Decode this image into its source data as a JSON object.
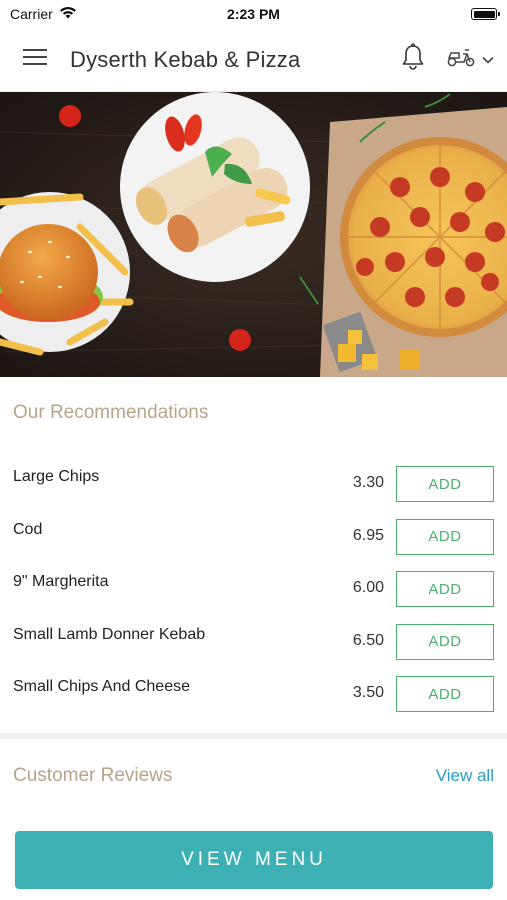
{
  "status_bar": {
    "carrier": "Carrier",
    "time": "2:23 PM",
    "wifi_icon": "wifi-icon",
    "battery_icon": "battery-icon"
  },
  "header": {
    "title": "Dyserth Kebab & Pizza",
    "menu_icon": "hamburger-menu-icon",
    "notification_icon": "bell-icon",
    "delivery_icon": "scooter-icon",
    "dropdown_icon": "chevron-down-icon"
  },
  "hero": {
    "image": "food-banner-burger-wrap-pizza"
  },
  "recommendations": {
    "title": "Our Recommendations",
    "add_label": "ADD",
    "items": [
      {
        "name": "Large Chips",
        "price": "3.30"
      },
      {
        "name": "Cod",
        "price": "6.95"
      },
      {
        "name": "9\" Margherita",
        "price": "6.00"
      },
      {
        "name": "Small Lamb Donner Kebab",
        "price": "6.50"
      },
      {
        "name": "Small Chips And Cheese",
        "price": "3.50"
      }
    ]
  },
  "reviews": {
    "title": "Customer Reviews",
    "view_all": "View all"
  },
  "cta": {
    "view_menu": "VIEW MENU"
  },
  "colors": {
    "section_title": "#b7a48a",
    "add_button": "#4caf6e",
    "link": "#2a9fc4",
    "cta_background": "#3cb0b3"
  }
}
